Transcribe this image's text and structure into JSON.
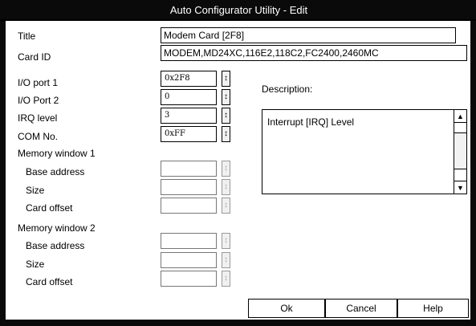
{
  "window": {
    "title": "Auto Configurator Utility - Edit"
  },
  "labels": {
    "title": "Title",
    "card_id": "Card ID",
    "io_port_1": "I/O port 1",
    "io_port_2": "I/O Port 2",
    "irq_level": "IRQ level",
    "com_no": "COM No.",
    "mem_window_1": "Memory window 1",
    "mem_window_2": "Memory window 2",
    "base_address": "Base address",
    "size": "Size",
    "card_offset": "Card offset",
    "description": "Description:"
  },
  "fields": {
    "title_value": "Modem Card [2F8]",
    "card_id_value": "MODEM,MD24XC,116E2,118C2,FC2400,2460MC",
    "io_port_1_value": "0x2F8",
    "io_port_2_value": "0",
    "irq_level_value": "3",
    "com_no_value": "0xFF",
    "mem1_base_value": "",
    "mem1_size_value": "",
    "mem1_offset_value": "",
    "mem2_base_value": "",
    "mem2_size_value": "",
    "mem2_offset_value": ""
  },
  "description_text": "Interrupt [IRQ] Level",
  "buttons": {
    "ok": "Ok",
    "cancel": "Cancel",
    "help": "Help"
  },
  "icons": {
    "spin": "spin-arrows-icon",
    "scroll_up": "scroll-up-icon",
    "scroll_down": "scroll-down-icon"
  }
}
